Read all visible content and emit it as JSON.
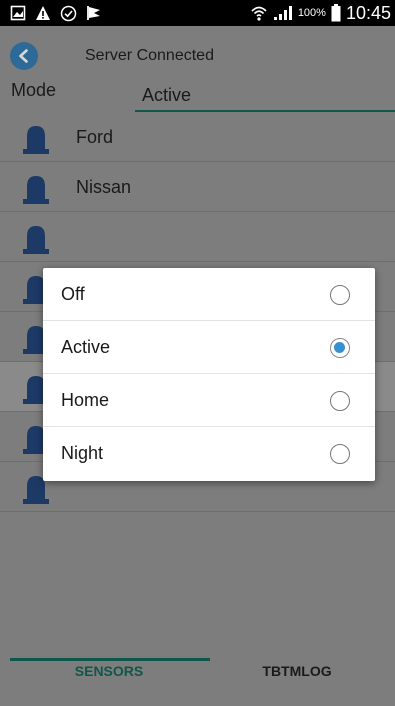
{
  "status_bar": {
    "left_icons": [
      "gallery-icon",
      "warning-icon",
      "check-circle-icon",
      "flag-icon"
    ],
    "battery_percent": "100%",
    "time": "10:45"
  },
  "header": {
    "connection_status": "Server Connected"
  },
  "mode": {
    "label": "Mode",
    "value": "Active"
  },
  "sensors": [
    {
      "name": "Ford"
    },
    {
      "name": "Nissan"
    },
    {
      "name": ""
    },
    {
      "name": ""
    },
    {
      "name": ""
    },
    {
      "name": ""
    },
    {
      "name": ""
    },
    {
      "name": ""
    }
  ],
  "mode_dialog": {
    "selected": "Active",
    "options": [
      {
        "label": "Off",
        "checked": false
      },
      {
        "label": "Active",
        "checked": true
      },
      {
        "label": "Home",
        "checked": false
      },
      {
        "label": "Night",
        "checked": false
      }
    ]
  },
  "tabs": [
    {
      "label": "SENSORS",
      "active": true
    },
    {
      "label": "TBTMLOG",
      "active": false
    }
  ],
  "colors": {
    "accent": "#0f574a",
    "radio_selected": "#3591cf",
    "back_button": "#2d6a97",
    "sensor_icon": "#1d3a66"
  }
}
